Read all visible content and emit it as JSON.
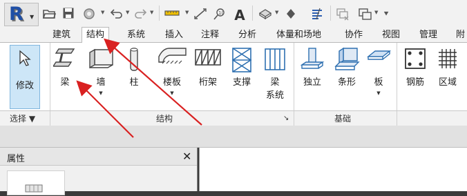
{
  "quick_access": {
    "icons": [
      "app-menu-r-icon",
      "open-folder-icon",
      "save-icon",
      "sync-icon",
      "undo-icon",
      "redo-icon",
      "measure-icon",
      "aligned-dimension-icon",
      "tag-icon",
      "text-a-icon",
      "view-3d-icon",
      "section-icon",
      "thin-lines-icon",
      "close-windows-icon",
      "switch-windows-icon",
      "customize-icon"
    ],
    "text_a": "A"
  },
  "tabs": [
    {
      "label": "建筑"
    },
    {
      "label": "结构",
      "active": true
    },
    {
      "label": "系统"
    },
    {
      "label": "插入"
    },
    {
      "label": "注释"
    },
    {
      "label": "分析"
    },
    {
      "label": "体量和场地"
    },
    {
      "label": "协作"
    },
    {
      "label": "视图"
    },
    {
      "label": "管理"
    },
    {
      "label": "附"
    }
  ],
  "ribbon": {
    "modify": {
      "label": "修改"
    },
    "buttons": [
      {
        "label": "梁"
      },
      {
        "label": "墙",
        "dropdown": true
      },
      {
        "label": "柱"
      },
      {
        "label": "楼板",
        "dropdown": true
      },
      {
        "label": "桁架"
      },
      {
        "label": "支撑"
      },
      {
        "label": "梁\n系统"
      },
      {
        "label": "独立"
      },
      {
        "label": "条形"
      },
      {
        "label": "板",
        "dropdown": true
      },
      {
        "label": "钢筋"
      },
      {
        "label": "区域"
      }
    ],
    "panels": [
      {
        "label": "选择 ▼"
      },
      {
        "label": "结构"
      },
      {
        "label": "基础"
      }
    ],
    "panel_launcher": "↘"
  },
  "properties": {
    "title": "属性",
    "close": "✕"
  },
  "colors": {
    "accent_blue": "#1f4fa6",
    "annotation_red": "#d92121",
    "selected_fill": "#cde6f7"
  }
}
